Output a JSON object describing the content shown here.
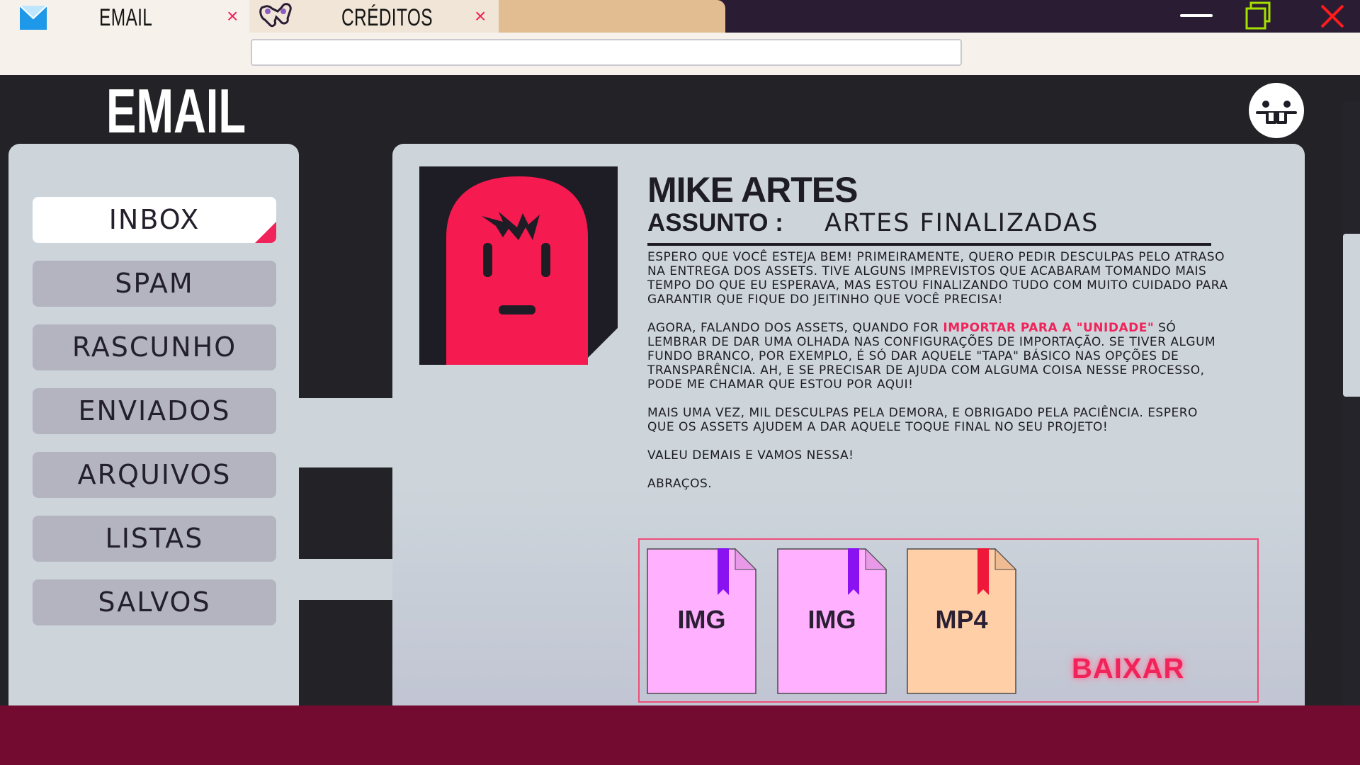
{
  "tabs": [
    {
      "label": "EMAIL",
      "icon": "envelope-icon",
      "close": "×"
    },
    {
      "label": "CRÉDITOS",
      "icon": "game-controller-icon",
      "close": "×"
    }
  ],
  "address_bar": {
    "value": ""
  },
  "app": {
    "title": "EMAIL",
    "avatar_icon": "goofy-face-icon"
  },
  "sidebar": {
    "items": [
      {
        "label": "INBOX",
        "active": true
      },
      {
        "label": "SPAM"
      },
      {
        "label": "RASCUNHO"
      },
      {
        "label": "ENVIADOS"
      },
      {
        "label": "ARQUIVOS"
      },
      {
        "label": "LISTAS"
      },
      {
        "label": "SALVOS"
      }
    ]
  },
  "message": {
    "sender": "MIKE ARTES",
    "subject_label": "ASSUNTO :",
    "subject": "ARTES FINALIZADAS",
    "paragraphs": [
      "ESPERO QUE VOCÊ ESTEJA BEM! PRIMEIRAMENTE, QUERO PEDIR DESCULPAS PELO ATRASO NA ENTREGA DOS ASSETS. TIVE ALGUNS IMPREVISTOS QUE ACABARAM TOMANDO MAIS TEMPO DO QUE EU ESPERAVA, MAS ESTOU FINALIZANDO TUDO COM MUITO CUIDADO PARA GARANTIR QUE FIQUE DO JEITINHO QUE VOCÊ PRECISA!",
      "",
      "MAIS UMA VEZ, MIL DESCULPAS PELA DEMORA, E OBRIGADO PELA PACIÊNCIA. ESPERO QUE OS ASSETS AJUDEM A DAR AQUELE TOQUE FINAL NO SEU PROJETO!",
      "VALEU DEMAIS E VAMOS NESSA!",
      "ABRAÇOS."
    ],
    "p2_before": "AGORA, FALANDO DOS ASSETS, QUANDO FOR ",
    "p2_highlight": "IMPORTAR PARA A \"UNIDADE\"",
    "p2_after": " SÓ LEMBRAR DE DAR UMA OLHADA NAS CONFIGURAÇÕES DE IMPORTAÇÃO. SE TIVER ALGUM FUNDO BRANCO, POR EXEMPLO, É SÓ DAR AQUELE \"TAPA\" BÁSICO NAS OPÇÕES DE TRANSPARÊNCIA. AH, E SE PRECISAR DE AJUDA COM ALGUMA COISA NESSE PROCESSO, PODE ME CHAMAR QUE ESTOU POR AQUI!",
    "attachments": [
      {
        "label": "IMG",
        "color": "#ffb0ff",
        "ribbon": "#8a12f0"
      },
      {
        "label": "IMG",
        "color": "#ffb0ff",
        "ribbon": "#8a12f0"
      },
      {
        "label": "MP4",
        "color": "#ffd0a8",
        "ribbon": "#f01838"
      }
    ],
    "download_label": "BAIXAR"
  },
  "colors": {
    "accent": "#f0245a",
    "dark": "#232226",
    "panel": "#cdd5db",
    "footer": "#730b31"
  }
}
